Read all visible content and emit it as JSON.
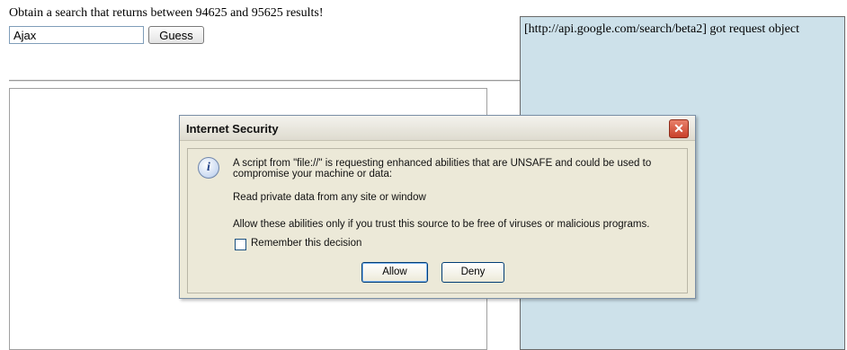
{
  "prompt": "Obtain a search that returns between 94625 and 95625 results!",
  "search": {
    "value": "Ajax",
    "button_label": "Guess"
  },
  "log_panel": {
    "text": "[http://api.google.com/search/beta2] got request object"
  },
  "dialog": {
    "title": "Internet Security",
    "message": "A script from \"file://\" is requesting enhanced abilities that are UNSAFE and could be used to compromise your machine or data:",
    "ability": "Read private data from any site or window",
    "advice": "Allow these abilities only if you trust this source to be free of viruses or malicious programs.",
    "remember_label": "Remember this decision",
    "remember_checked": false,
    "allow_label": "Allow",
    "deny_label": "Deny"
  }
}
